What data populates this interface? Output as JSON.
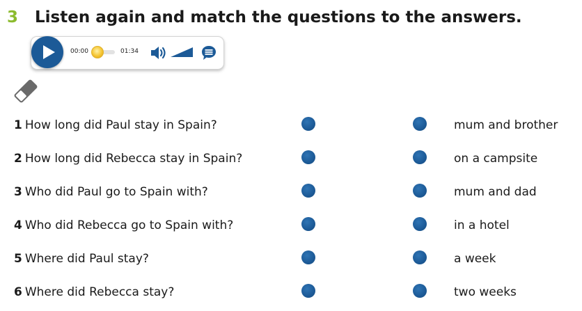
{
  "exercise": {
    "number": "3",
    "title": "Listen again and match the questions to the answers."
  },
  "audio": {
    "current_time": "00:00",
    "total_time": "01:34",
    "progress": 0
  },
  "questions": [
    {
      "num": "1",
      "text": "How long did Paul stay in Spain?"
    },
    {
      "num": "2",
      "text": "How long did Rebecca stay in Spain?"
    },
    {
      "num": "3",
      "text": "Who did Paul go to Spain with?"
    },
    {
      "num": "4",
      "text": "Who did Rebecca go to Spain with?"
    },
    {
      "num": "5",
      "text": "Where did Paul stay?"
    },
    {
      "num": "6",
      "text": "Where did Rebecca stay?"
    }
  ],
  "answers": [
    "mum and brother",
    "on a campsite",
    "mum and dad",
    "in a hotel",
    "a week",
    "two weeks"
  ],
  "icons": {
    "play": "play-icon",
    "volume": "volume-icon",
    "volume_level": "volume-level-icon",
    "transcript": "transcript-icon",
    "eraser": "eraser-icon"
  },
  "colors": {
    "accent_green": "#8cbb2e",
    "primary_blue": "#1c5a97",
    "thumb_yellow": "#f5c532"
  }
}
